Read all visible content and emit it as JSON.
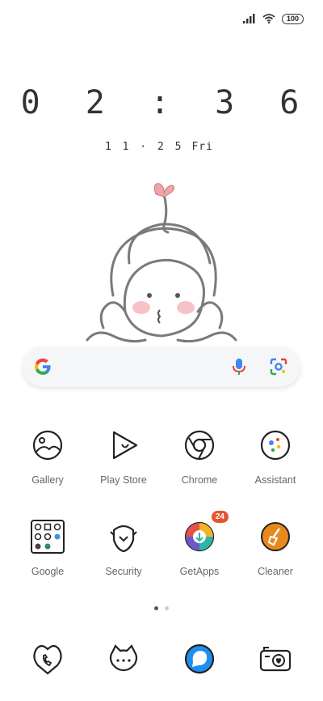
{
  "status_bar": {
    "battery": "100",
    "icons": [
      "signal-icon",
      "wifi-icon",
      "battery-icon"
    ]
  },
  "clock": {
    "time": "0 2 : 3 6",
    "date": "1 1 · 2 5",
    "day": "Fri"
  },
  "search": {
    "icons": [
      "google-logo-icon",
      "microphone-icon",
      "lens-camera-icon"
    ]
  },
  "apps_row1": [
    {
      "label": "Gallery",
      "icon": "gallery-icon"
    },
    {
      "label": "Play Store",
      "icon": "play-store-icon"
    },
    {
      "label": "Chrome",
      "icon": "chrome-icon"
    },
    {
      "label": "Assistant",
      "icon": "assistant-icon"
    }
  ],
  "apps_row2": [
    {
      "label": "Google",
      "icon": "google-folder-icon"
    },
    {
      "label": "Security",
      "icon": "security-icon"
    },
    {
      "label": "GetApps",
      "icon": "getapps-icon",
      "badge": "24"
    },
    {
      "label": "Cleaner",
      "icon": "cleaner-icon"
    }
  ],
  "page_indicator": {
    "pages": 2,
    "current": 1
  },
  "dock": [
    {
      "icon": "phone-icon"
    },
    {
      "icon": "messages-icon"
    },
    {
      "icon": "browser-icon"
    },
    {
      "icon": "camera-icon"
    }
  ],
  "colors": {
    "badge": "#e4572e",
    "cleaner": "#e8891c",
    "browser": "#1f8ef1",
    "heart": "#f0a3a8"
  }
}
